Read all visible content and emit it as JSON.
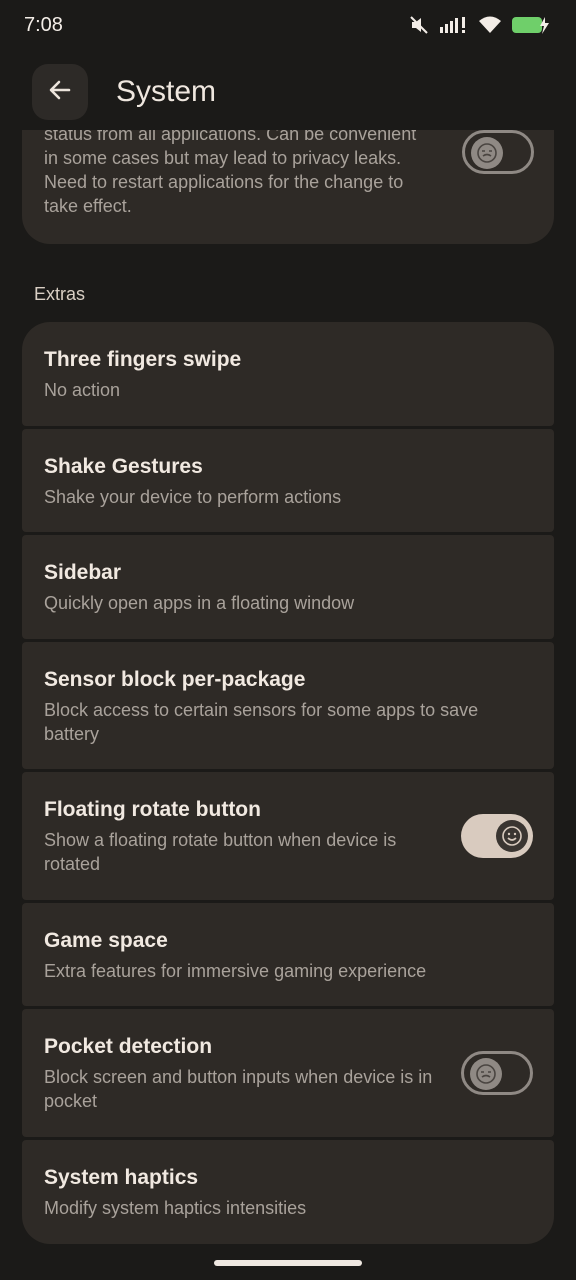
{
  "status_bar": {
    "time": "7:08",
    "icons": [
      "mute-icon",
      "signal-icon",
      "wifi-icon",
      "battery-charging-icon"
    ],
    "battery_color": "#6fcf6a"
  },
  "app_bar": {
    "title": "System",
    "back_icon": "arrow-left-icon"
  },
  "partial_item": {
    "summary": "status from all applications. Can be convenient in some cases but may lead to privacy leaks. Need to restart applications for the change to take effect.",
    "toggle": "off"
  },
  "section": {
    "header": "Extras"
  },
  "items": [
    {
      "title": "Three fingers swipe",
      "summary": "No action"
    },
    {
      "title": "Shake Gestures",
      "summary": "Shake your device to perform actions"
    },
    {
      "title": "Sidebar",
      "summary": "Quickly open apps in a floating window"
    },
    {
      "title": "Sensor block per-package",
      "summary": "Block access to certain sensors for some apps to save battery"
    },
    {
      "title": "Floating rotate button",
      "summary": "Show a floating rotate button when device is rotated",
      "toggle": "on"
    },
    {
      "title": "Game space",
      "summary": "Extra features for immersive gaming experience"
    },
    {
      "title": "Pocket detection",
      "summary": "Block screen and button inputs when device is in pocket",
      "toggle": "off"
    },
    {
      "title": "System haptics",
      "summary": "Modify system haptics intensities"
    }
  ],
  "colors": {
    "background": "#1b1a18",
    "card": "#2e2a26",
    "switch_on_track": "#d9cbbf"
  }
}
